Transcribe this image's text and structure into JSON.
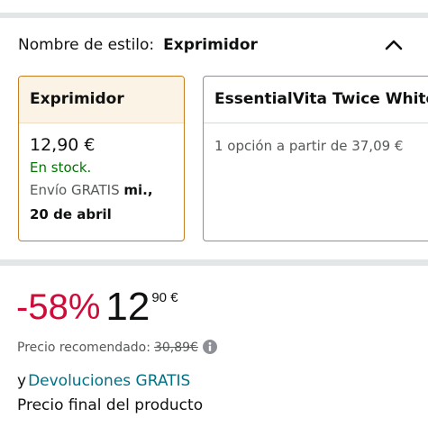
{
  "style_selector": {
    "label": "Nombre de estilo:",
    "selected_value": "Exprimidor",
    "expanded_icon": "chevron-up-icon"
  },
  "options": [
    {
      "title": "Exprimidor",
      "selected": true,
      "price": "12,90 €",
      "stock": "En stock.",
      "shipping_prefix": "Envío GRATIS",
      "shipping_day": "mi.,",
      "shipping_date": "20 de abril"
    },
    {
      "title": "EssentialVita Twice White",
      "selected": false,
      "options_text": "1 opción a partir de 37,09 €"
    }
  ],
  "pricing": {
    "discount": "-58%",
    "price_whole": "12",
    "price_fraction": "90 €",
    "list_price_label": "Precio recomendado:",
    "list_price_value": "30,89€",
    "info_icon": "info-icon"
  },
  "returns": {
    "prefix": "y",
    "link_text": "Devoluciones GRATIS"
  },
  "final_price_text": "Precio final del producto",
  "colors": {
    "discount": "#cc0c39",
    "in_stock": "#007600",
    "link": "#007185",
    "selected_border": "#c77d22",
    "selected_header_bg": "#fbf3e6"
  }
}
